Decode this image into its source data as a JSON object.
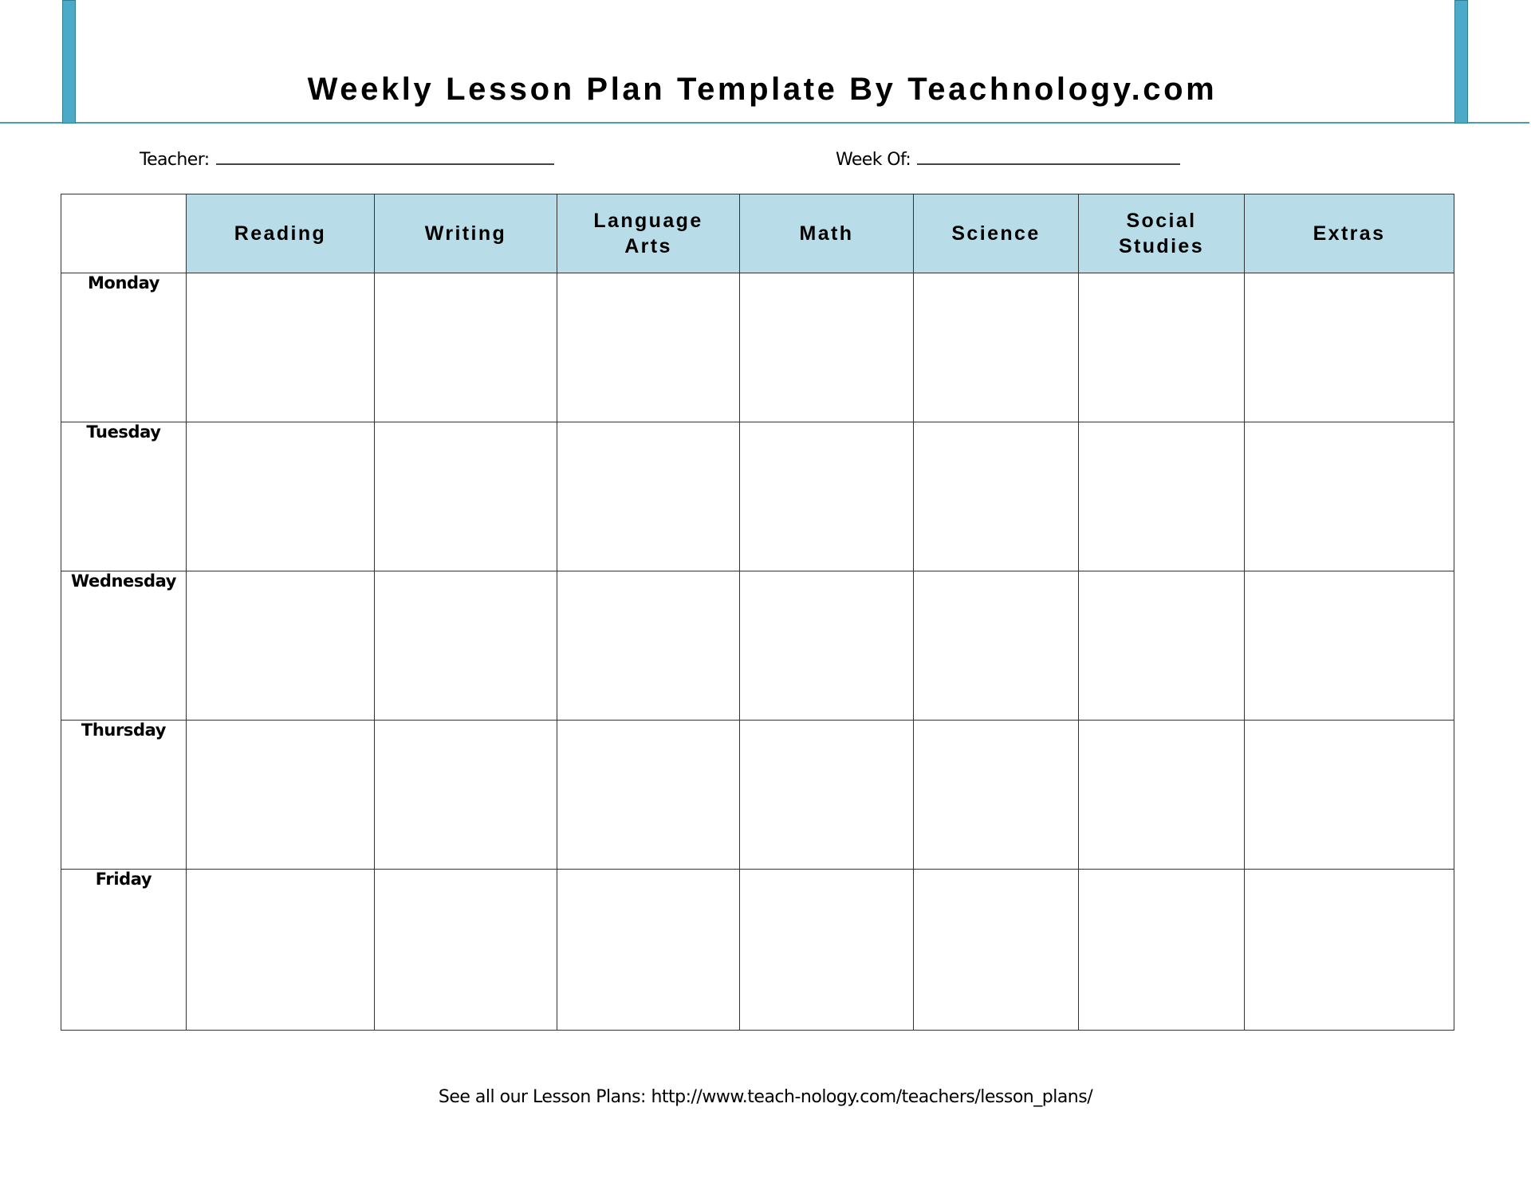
{
  "header": {
    "title": "Weekly Lesson Plan Template By Teachnology.com",
    "accent_color": "#4aaac8",
    "header_fill_color": "#b8dde8"
  },
  "fields": {
    "teacher_label": "Teacher:",
    "teacher_value": "",
    "week_of_label": "Week Of:",
    "week_of_value": ""
  },
  "table": {
    "columns": [
      "Reading",
      "Writing",
      "Language Arts",
      "Math",
      "Science",
      "Social Studies",
      "Extras"
    ],
    "rows": [
      {
        "day": "Monday",
        "cells": [
          "",
          "",
          "",
          "",
          "",
          "",
          ""
        ]
      },
      {
        "day": "Tuesday",
        "cells": [
          "",
          "",
          "",
          "",
          "",
          "",
          ""
        ]
      },
      {
        "day": "Wednesday",
        "cells": [
          "",
          "",
          "",
          "",
          "",
          "",
          ""
        ]
      },
      {
        "day": "Thursday",
        "cells": [
          "",
          "",
          "",
          "",
          "",
          "",
          ""
        ]
      },
      {
        "day": "Friday",
        "cells": [
          "",
          "",
          "",
          "",
          "",
          "",
          ""
        ]
      }
    ]
  },
  "footer": {
    "text": "See all our Lesson Plans: http://www.teach-nology.com/teachers/lesson_plans/"
  }
}
